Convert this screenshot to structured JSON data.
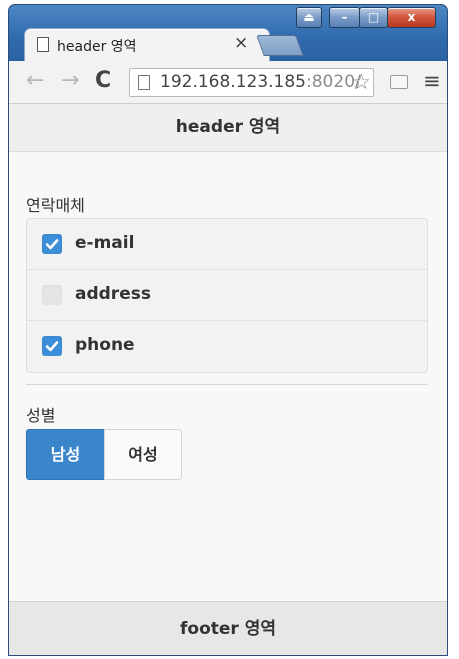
{
  "browser": {
    "tab": {
      "title": "header 영역",
      "close_glyph": "×"
    },
    "address": {
      "host": "192.168.123.185",
      "port": ":8020/"
    },
    "icons": {
      "back": "←",
      "forward": "→",
      "reload": "C",
      "menu": "≡",
      "star": "☆",
      "minimize": "–",
      "maximize": "□",
      "close": "x",
      "user": "⏏"
    }
  },
  "app": {
    "header": "header 영역",
    "contact": {
      "label": "연락매체",
      "options": [
        {
          "label": "e-mail",
          "checked": true
        },
        {
          "label": "address",
          "checked": false
        },
        {
          "label": "phone",
          "checked": true
        }
      ]
    },
    "gender": {
      "label": "성별",
      "options": [
        {
          "label": "남성",
          "selected": true
        },
        {
          "label": "여성",
          "selected": false
        }
      ]
    },
    "footer": "footer 영역"
  },
  "colors": {
    "accent": "#3b86ca",
    "checkbox_on": "#3c8ed8",
    "window_frame": "#1f5f99"
  }
}
